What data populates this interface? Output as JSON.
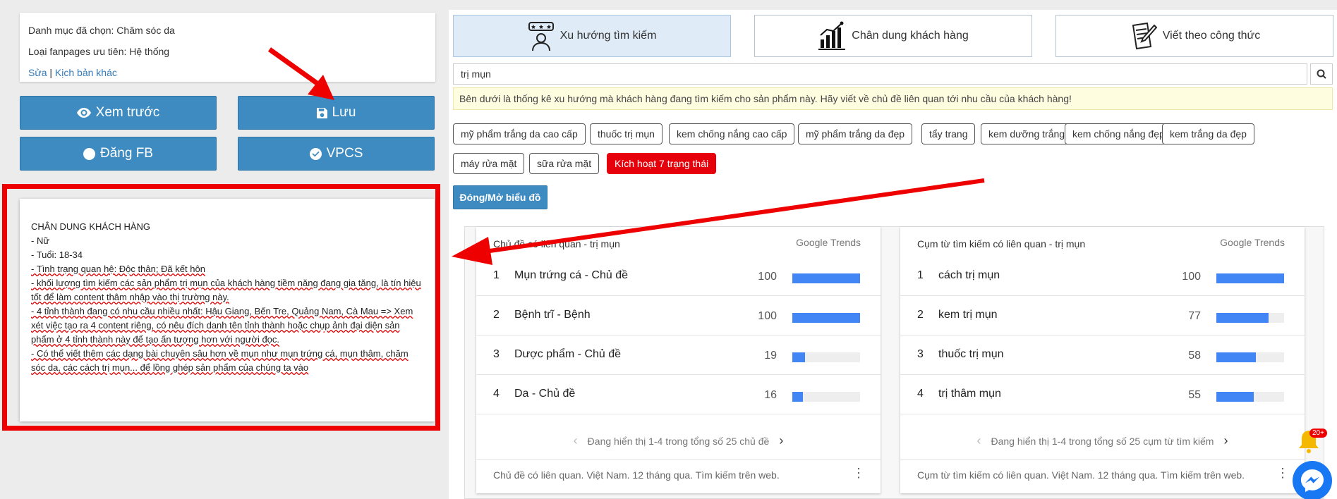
{
  "left": {
    "info": {
      "category_line": "Danh mục đã chọn: Chăm sóc da",
      "fanpage_line": "Loại fanpages ưu tiên: Hệ thống",
      "edit_link": "Sửa",
      "separator": "|",
      "other_script_link": "Kịch bản khác"
    },
    "buttons": {
      "preview": "Xem trước",
      "save": "Lưu",
      "post_fb": "Đăng FB",
      "vpcs": "VPCS"
    },
    "note": {
      "heading": "CHÂN DUNG KHÁCH HÀNG",
      "lines": [
        "- Nữ",
        "- Tuổi: 18-34",
        "- Tình trạng quan hệ: Độc thân; Đã kết hôn",
        "- khối lượng tìm kiếm các sản phẩm trị mụn của khách hàng tiềm năng đang gia tăng, là tín hiệu tốt để làm content thâm nhập vào thị trường này.",
        "- 4 tỉnh thành đang có nhu cầu nhiều nhất: Hậu Giang, Bến Tre, Quảng Nam, Cà Mau => Xem xét việc tạo ra 4 content riêng, có nêu đích danh tên tỉnh thành hoặc chụp ảnh đại diện sản phẩm ở 4 tỉnh thành này để tạo ấn tượng hơn với người đọc.",
        "- Có thể viết thêm các dạng bài chuyên sâu hơn về mụn như mụn trứng cá, mụn thâm, chăm sóc da, các cách trị mụn... để lồng ghép sản phẩm của chúng ta vào"
      ]
    }
  },
  "tabs": [
    {
      "label": "Xu hướng tìm kiếm",
      "icon": "people-rating-icon"
    },
    {
      "label": "Chân dung khách hàng",
      "icon": "bar-chart-icon"
    },
    {
      "label": "Viết theo công thức",
      "icon": "document-pen-icon"
    }
  ],
  "search": {
    "value": "trị mụn"
  },
  "alert_text": "Bên dưới là thống kê xu hướng mà khách hàng đang tìm kiếm cho sản phẩm này. Hãy viết về chủ đề liên quan tới nhu cầu của khách hàng!",
  "tags": [
    "mỹ phẩm trắng da cao cấp",
    "thuốc trị mụn",
    "kem chống nắng cao cấp",
    "mỹ phẩm trắng da đẹp",
    "tẩy trang",
    "kem dưỡng trắng",
    "kem chống nắng đẹp",
    "kem trắng da đẹp",
    "máy rửa mặt",
    "sữa rửa mặt"
  ],
  "activate_label": "Kích hoạt 7 trạng thái",
  "toggle_chart_label": "Đóng/Mở biểu đồ",
  "widgets": [
    {
      "title": "Chủ đề có liên quan - trị mụn",
      "brand": "Google Trends",
      "rows": [
        {
          "rank": "1",
          "label": "Mụn trứng cá - Chủ đề",
          "value": 100
        },
        {
          "rank": "2",
          "label": "Bệnh trĩ - Bệnh",
          "value": 100
        },
        {
          "rank": "3",
          "label": "Dược phẩm - Chủ đề",
          "value": 19
        },
        {
          "rank": "4",
          "label": "Da - Chủ đề",
          "value": 16
        }
      ],
      "pager": "Đang hiển thị 1-4 trong tổng số 25 chủ đề",
      "source": "Chủ đề có liên quan. Việt Nam. 12 tháng qua. Tìm kiếm trên web."
    },
    {
      "title": "Cụm từ tìm kiếm có liên quan - trị mụn",
      "brand": "Google Trends",
      "rows": [
        {
          "rank": "1",
          "label": "cách trị mụn",
          "value": 100
        },
        {
          "rank": "2",
          "label": "kem trị mụn",
          "value": 77
        },
        {
          "rank": "3",
          "label": "thuốc trị mụn",
          "value": 58
        },
        {
          "rank": "4",
          "label": "trị thâm mụn",
          "value": 55
        }
      ],
      "pager": "Đang hiển thị 1-4 trong tổng số 25 cụm từ tìm kiếm",
      "source": "Cụm từ tìm kiếm có liên quan. Việt Nam. 12 tháng qua. Tìm kiếm trên web."
    }
  ],
  "notification_badge": "20+",
  "colors": {
    "primary": "#3d8bc0",
    "highlight_red": "#e5000b",
    "bar_blue": "#4285f4"
  }
}
